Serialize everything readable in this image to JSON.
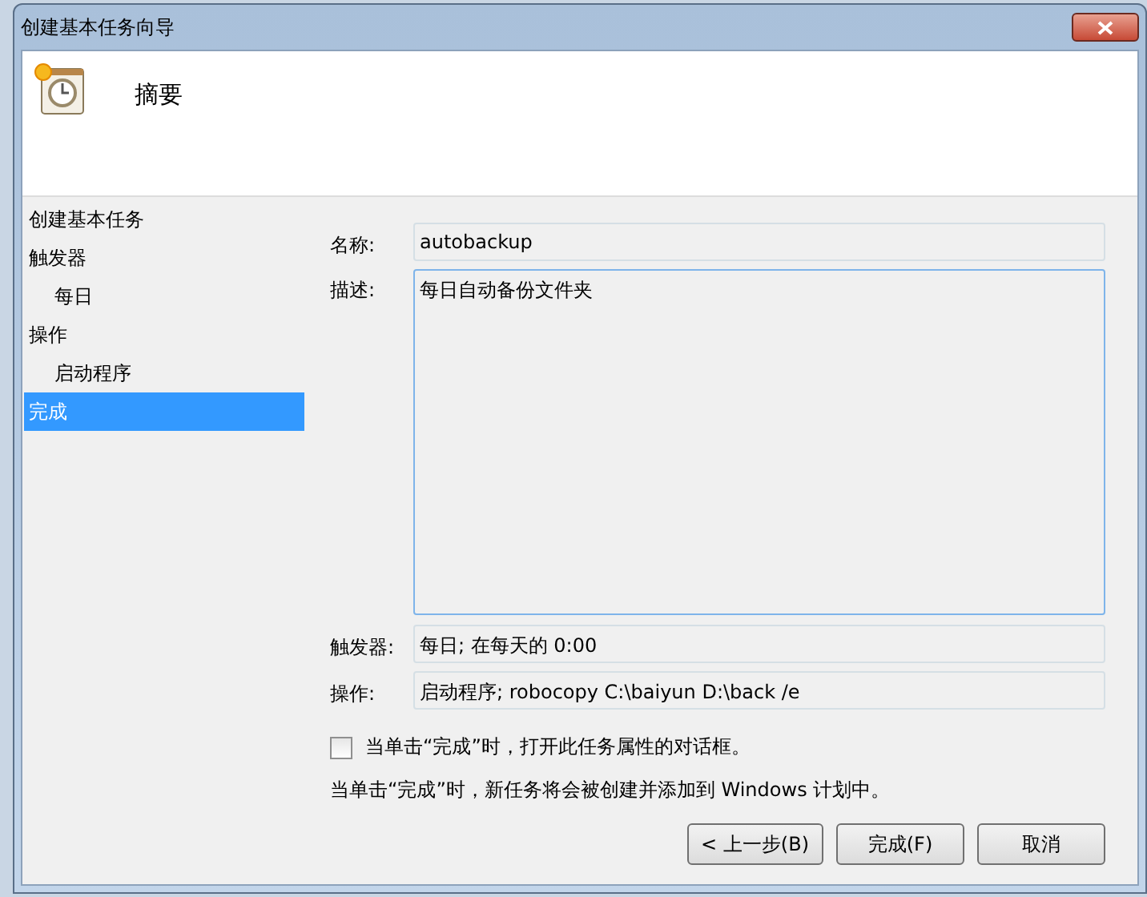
{
  "window": {
    "title": "创建基本任务向导"
  },
  "header": {
    "title": "摘要"
  },
  "sidebar": {
    "items": [
      {
        "label": "创建基本任务",
        "selected": false
      },
      {
        "label": "触发器",
        "selected": false,
        "children": [
          {
            "label": "每日",
            "selected": false
          }
        ]
      },
      {
        "label": "操作",
        "selected": false,
        "children": [
          {
            "label": "启动程序",
            "selected": false
          }
        ]
      },
      {
        "label": "完成",
        "selected": true
      }
    ]
  },
  "fields": [
    {
      "label": "名称:",
      "value": "autobackup",
      "kind": "line"
    },
    {
      "label": "描述:",
      "value": "每日自动备份文件夹",
      "kind": "area"
    },
    {
      "label": "触发器:",
      "value": "每日; 在每天的 0:00",
      "kind": "readonly"
    },
    {
      "label": "操作:",
      "value": "启动程序; robocopy C:\\baiyun D:\\back /e",
      "kind": "readonly"
    }
  ],
  "open_properties": {
    "label": "当单击“完成”时，打开此任务属性的对话框。",
    "checked": false
  },
  "note": "当单击“完成”时，新任务将会被创建并添加到 Windows 计划中。",
  "buttons": [
    "< 上一步(B)",
    "完成(F)",
    "取消"
  ]
}
